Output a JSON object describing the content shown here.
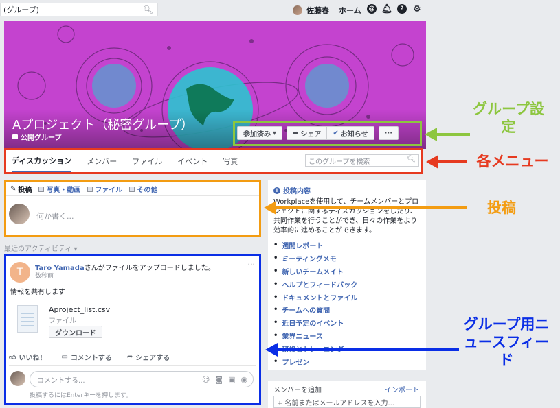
{
  "topbar": {
    "search_value": "(グループ)",
    "user_name": "佐藤春",
    "home_label": "ホーム"
  },
  "group": {
    "title": "Aプロジェクト（秘密グループ）",
    "type": "公開グループ"
  },
  "actions": {
    "joined": "参加済み",
    "share": "シェア",
    "notify": "お知らせ",
    "more": "···"
  },
  "tabs": [
    {
      "label": "ディスカッション"
    },
    {
      "label": "メンバー"
    },
    {
      "label": "ファイル"
    },
    {
      "label": "イベント"
    },
    {
      "label": "写真"
    }
  ],
  "tab_search_placeholder": "このグループを検索",
  "composer": {
    "tabs": [
      {
        "label": "投稿"
      },
      {
        "label": "写真・動画"
      },
      {
        "label": "ファイル"
      },
      {
        "label": "その他"
      }
    ],
    "placeholder": "何か書く..."
  },
  "recent_label": "最近のアクティビティ ▾",
  "post": {
    "avatar_letter": "T",
    "author": "Taro Yamada",
    "action_text": "さんがファイルをアップロードしました。",
    "time": "数秒前",
    "text": "情報を共有します",
    "file_name": "Aproject_list.csv",
    "file_type": "ファイル",
    "download": "ダウンロード",
    "like": "いいね！",
    "comment": "コメントする",
    "share": "シェアする",
    "comment_placeholder": "コメントする...",
    "comment_hint": "投稿するにはEnterキーを押します。"
  },
  "about": {
    "title": "投稿内容",
    "description": "Workplaceを使用して、チームメンバーとプロジェクトに関するディスカッションをしたり、共同作業を行うことができ、日々の作業をより効率的に進めることができます。",
    "links": [
      {
        "label": "週間レポート"
      },
      {
        "label": "ミーティングメモ"
      },
      {
        "label": "新しいチームメイト"
      },
      {
        "label": "ヘルプとフィードバック"
      },
      {
        "label": "ドキュメントとファイル"
      },
      {
        "label": "チームへの質問"
      },
      {
        "label": "近日予定のイベント"
      },
      {
        "label": "業界ニュース"
      },
      {
        "label": "研修とトレーニング"
      },
      {
        "label": "プレゼン"
      }
    ]
  },
  "members": {
    "title": "メンバーを追加",
    "import": "インポート",
    "input_placeholder": "+ 名前またはメールアドレスを入力..."
  },
  "annotations": {
    "group_settings": "グループ設定",
    "menus": "各メニュー",
    "posting": "投稿",
    "newsfeed": "グループ用ニュースフィード"
  },
  "colors": {
    "cover": "#c443cf",
    "green": "#8dc63f",
    "red": "#e63a20",
    "orange": "#f39c12",
    "blue": "#0a2ee6",
    "link": "#4267b2"
  }
}
